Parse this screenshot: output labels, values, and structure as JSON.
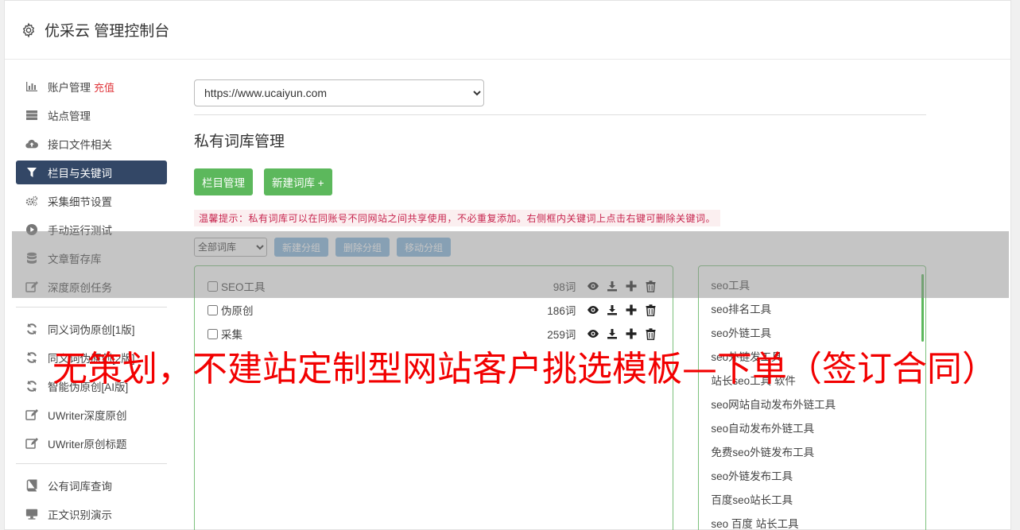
{
  "header": {
    "title": "优采云 管理控制台"
  },
  "sidebar": {
    "groups": [
      [
        {
          "label": "账户管理",
          "badge": "充值",
          "icon": "bar-chart-icon"
        },
        {
          "label": "站点管理",
          "icon": "server-icon"
        },
        {
          "label": "接口文件相关",
          "icon": "cloud-upload-icon"
        },
        {
          "label": "栏目与关键词",
          "icon": "filter-icon",
          "active": true
        },
        {
          "label": "采集细节设置",
          "icon": "cogs-icon"
        },
        {
          "label": "手动运行测试",
          "icon": "play-circle-icon"
        },
        {
          "label": "文章暂存库",
          "icon": "database-icon"
        },
        {
          "label": "深度原创任务",
          "icon": "edit-icon"
        }
      ],
      [
        {
          "label": "同义词伪原创[1版]",
          "icon": "refresh-icon"
        },
        {
          "label": "同义词伪原创[2版]",
          "icon": "refresh-icon"
        },
        {
          "label": "智能伪原创[AI版]",
          "icon": "refresh-icon"
        },
        {
          "label": "UWriter深度原创",
          "icon": "edit-icon"
        },
        {
          "label": "UWriter原创标题",
          "icon": "edit-icon"
        }
      ],
      [
        {
          "label": "公有词库查询",
          "icon": "book-icon"
        },
        {
          "label": "正文识别演示",
          "icon": "desktop-icon"
        }
      ]
    ]
  },
  "main": {
    "site_select": {
      "selected": "https://www.ucaiyun.com"
    },
    "section_title": "私有词库管理",
    "buttons": {
      "columns": "栏目管理",
      "new_library": "新建词库 +"
    },
    "tip": "温馨提示：私有词库可以在同账号不同网站之间共享使用，不必重复添加。右侧框内关键词上点击右键可删除关键词。",
    "toolbar": {
      "filter_selected": "全部词库",
      "new_group": "新建分组",
      "delete_group": "删除分组",
      "move_group": "移动分组"
    },
    "libraries": [
      {
        "name": "SEO工具",
        "count": "98词"
      },
      {
        "name": "伪原创",
        "count": "186词"
      },
      {
        "name": "采集",
        "count": "259词"
      }
    ],
    "keywords": [
      "seo工具",
      "seo排名工具",
      "seo外链工具",
      "seo外链发工具",
      "站长seo工具 软件",
      "seo网站自动发布外链工具",
      "seo自动发布外链工具",
      "免费seo外链发布工具",
      "seo外链发布工具",
      "百度seo站长工具",
      "seo 百度 站长工具"
    ]
  },
  "watermark": "无策划，不建站定制型网站客户挑选模板—下单（签订合同）",
  "colors": {
    "active_nav": "#334766",
    "green": "#5cb85c",
    "blue_btn": "#82b4dd",
    "tip_text": "#c7254e",
    "watermark": "#f20000"
  }
}
